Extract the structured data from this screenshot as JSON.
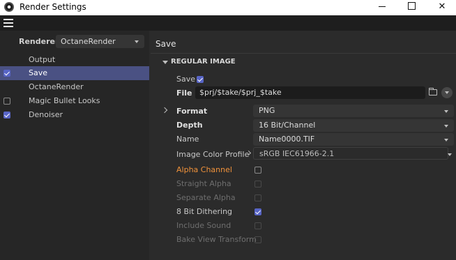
{
  "window": {
    "title": "Render Settings"
  },
  "titlebar": {
    "minimize": "—",
    "maximize": "☐",
    "close": "✕"
  },
  "menubar": {
    "menu_icon": "hamburger-menu-icon"
  },
  "left_panel": {
    "renderer_label": "Renderer",
    "renderer_value": "OctaneRender",
    "items": [
      {
        "label": "Output",
        "checkbox": "none",
        "selected": false
      },
      {
        "label": "Save",
        "checkbox": "checked",
        "selected": true
      },
      {
        "label": "OctaneRender",
        "checkbox": "none",
        "selected": false
      },
      {
        "label": "Magic Bullet Looks",
        "checkbox": "unchecked",
        "selected": false
      },
      {
        "label": "Denoiser",
        "checkbox": "checked",
        "selected": false
      }
    ]
  },
  "right_panel": {
    "section_title": "Save",
    "group_title": "REGULAR IMAGE",
    "save_label": "Save",
    "save_checked": true,
    "file_label": "File",
    "file_value": "$prj/$take/$prj_$take",
    "format_label": "Format",
    "format_value": "PNG",
    "depth_label": "Depth",
    "depth_value": "16 Bit/Channel",
    "name_label": "Name",
    "name_value": "Name0000.TIF",
    "profile_label": "Image Color Profile",
    "profile_value": "sRGB IEC61966-2.1",
    "options": [
      {
        "label": "Alpha Channel",
        "checked": false,
        "style": "orange"
      },
      {
        "label": "Straight Alpha",
        "checked": false,
        "style": "dim"
      },
      {
        "label": "Separate Alpha",
        "checked": false,
        "style": "dim"
      },
      {
        "label": "8 Bit Dithering",
        "checked": true,
        "style": "normal"
      },
      {
        "label": "Include Sound",
        "checked": false,
        "style": "dim"
      },
      {
        "label": "Bake View Transform",
        "checked": false,
        "style": "dim"
      }
    ]
  },
  "colors": {
    "accent": "#5865c6",
    "selection": "#4a5183",
    "alpha_label": "#f0923b"
  }
}
